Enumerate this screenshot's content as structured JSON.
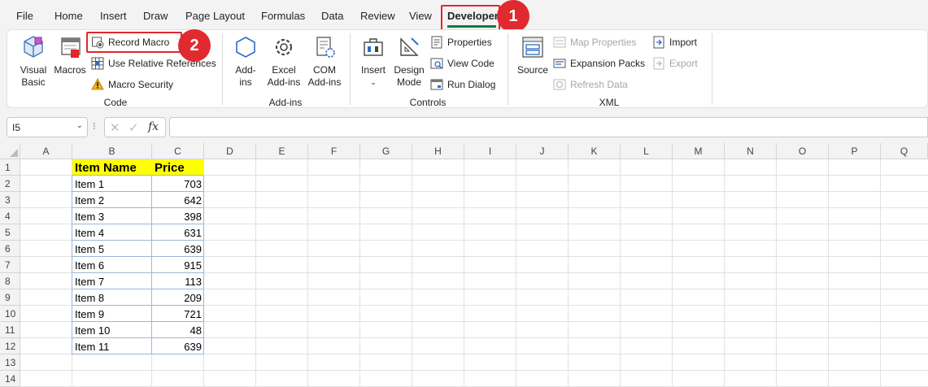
{
  "menu": {
    "tabs": [
      "File",
      "Home",
      "Insert",
      "Draw",
      "Page Layout",
      "Formulas",
      "Data",
      "Review",
      "View",
      "Developer"
    ],
    "active": "Developer"
  },
  "callouts": {
    "one": "1",
    "two": "2"
  },
  "ribbon": {
    "code": {
      "label": "Code",
      "visual_basic": "Visual Basic",
      "macros": "Macros",
      "record_macro": "Record Macro",
      "use_relative": "Use Relative References",
      "macro_security": "Macro Security"
    },
    "addins": {
      "label": "Add-ins",
      "addins_l1": "Add-",
      "addins_l2": "ins",
      "excel_l1": "Excel",
      "excel_l2": "Add-ins",
      "com_l1": "COM",
      "com_l2": "Add-ins"
    },
    "controls": {
      "label": "Controls",
      "insert": "Insert",
      "design_l1": "Design",
      "design_l2": "Mode",
      "properties": "Properties",
      "view_code": "View Code",
      "run_dialog": "Run Dialog"
    },
    "xml": {
      "label": "XML",
      "source": "Source",
      "map_properties": "Map Properties",
      "expansion_packs": "Expansion Packs",
      "refresh_data": "Refresh Data",
      "import": "Import",
      "export": "Export"
    }
  },
  "formula_bar": {
    "name_box": "I5",
    "fx": "fx",
    "formula": ""
  },
  "columns": [
    "A",
    "B",
    "C",
    "D",
    "E",
    "F",
    "G",
    "H",
    "I",
    "J",
    "K",
    "L",
    "M",
    "N",
    "O",
    "P",
    "Q"
  ],
  "rows": [
    "1",
    "2",
    "3",
    "4",
    "5",
    "6",
    "7",
    "8",
    "9",
    "10",
    "11",
    "12",
    "13",
    "14"
  ],
  "table": {
    "headers": [
      "Item Name",
      "Price"
    ],
    "rows": [
      [
        "Item 1",
        "703"
      ],
      [
        "Item 2",
        "642"
      ],
      [
        "Item 3",
        "398"
      ],
      [
        "Item 4",
        "631"
      ],
      [
        "Item 5",
        "639"
      ],
      [
        "Item 6",
        "915"
      ],
      [
        "Item 7",
        "113"
      ],
      [
        "Item 8",
        "209"
      ],
      [
        "Item 9",
        "721"
      ],
      [
        "Item 10",
        "48"
      ],
      [
        "Item 11",
        "639"
      ]
    ]
  },
  "colors": {
    "accent_green": "#107c41",
    "callout_red": "#e02a2f",
    "header_fill": "#ffff00"
  }
}
